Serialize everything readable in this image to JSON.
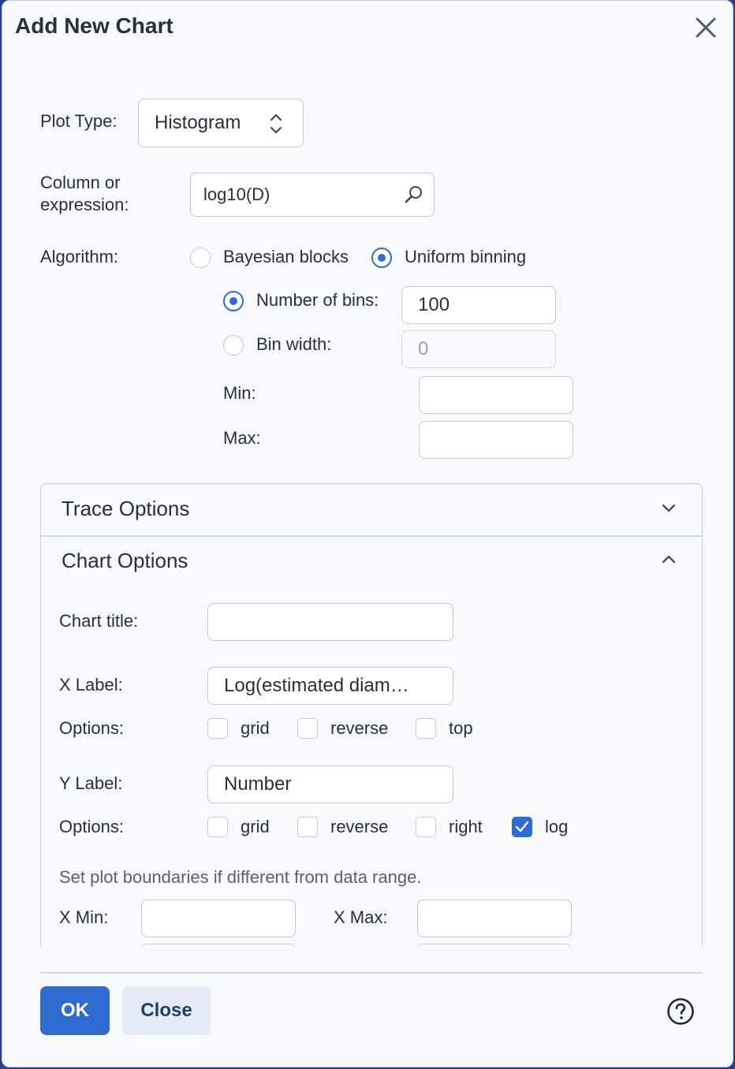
{
  "dialog": {
    "title": "Add New Chart"
  },
  "form": {
    "plot_type_label": "Plot Type:",
    "plot_type_value": "Histogram",
    "column_label_line1": "Column or",
    "column_label_line2": "expression:",
    "column_value": "log10(D)",
    "algorithm_label": "Algorithm:",
    "algorithm_options": [
      {
        "label": "Bayesian blocks",
        "selected": false
      },
      {
        "label": "Uniform binning",
        "selected": true
      }
    ],
    "num_bins_label": "Number of bins:",
    "num_bins_value": "100",
    "num_bins_selected": true,
    "bin_width_label": "Bin width:",
    "bin_width_value": "0",
    "bin_width_selected": false,
    "min_label": "Min:",
    "min_value": "",
    "max_label": "Max:",
    "max_value": ""
  },
  "trace_options": {
    "title": "Trace Options",
    "expanded": false,
    "icon": "chevron-down-icon"
  },
  "chart_options": {
    "title": "Chart Options",
    "expanded": true,
    "icon": "chevron-up-icon",
    "chart_title_label": "Chart title:",
    "chart_title_value": "",
    "x_label_label": "X Label:",
    "x_label_value": "Log(estimated diam…",
    "x_options_label": "Options:",
    "x_options": [
      {
        "label": "grid",
        "checked": false
      },
      {
        "label": "reverse",
        "checked": false
      },
      {
        "label": "top",
        "checked": false
      }
    ],
    "y_label_label": "Y Label:",
    "y_label_value": "Number",
    "y_options_label": "Options:",
    "y_options": [
      {
        "label": "grid",
        "checked": false
      },
      {
        "label": "reverse",
        "checked": false
      },
      {
        "label": "right",
        "checked": false
      },
      {
        "label": "log",
        "checked": true
      }
    ],
    "boundaries_note": "Set plot boundaries if different from data range.",
    "x_min_label": "X Min:",
    "x_min_value": "",
    "x_max_label": "X Max:",
    "x_max_value": ""
  },
  "footer": {
    "ok_label": "OK",
    "close_label": "Close",
    "help_icon": "help-icon"
  },
  "colors": {
    "accent": "#2f6bd0",
    "secondary_button_bg": "#e4ebf5",
    "dialog_bg": "#f7f9fc"
  }
}
